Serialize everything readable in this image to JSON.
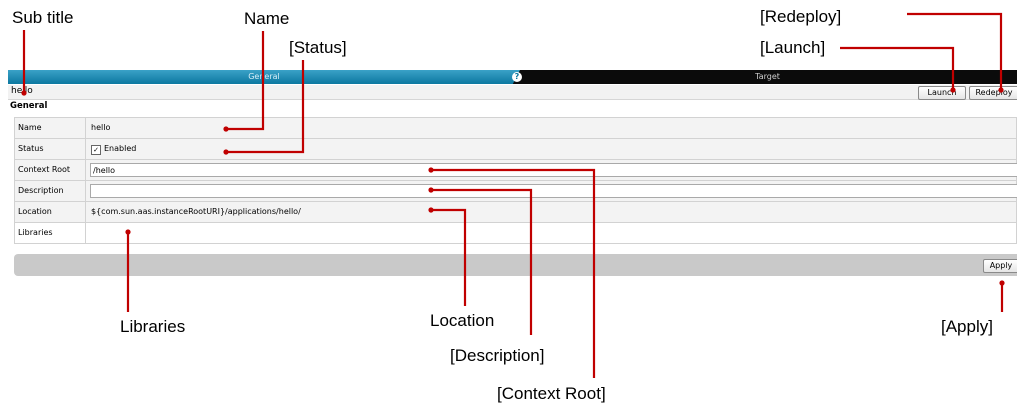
{
  "tabs": [
    {
      "label": "General",
      "active": true
    },
    {
      "label": "Target",
      "active": false
    }
  ],
  "help_icon_glyph": "?",
  "subtitle": "hello",
  "buttons": {
    "launch": "Launch",
    "redeploy": "Redeploy",
    "apply": "Apply"
  },
  "section_title": "General",
  "form": {
    "name_label": "Name",
    "name_value": "hello",
    "status_label": "Status",
    "status_value": "Enabled",
    "status_checked": true,
    "context_root_label": "Context Root",
    "context_root_value": "/hello",
    "description_label": "Description",
    "description_value": "",
    "location_label": "Location",
    "location_value": "${com.sun.aas.instanceRootURI}/applications/hello/",
    "libraries_label": "Libraries"
  },
  "annotations": {
    "sub_title": "Sub title",
    "name": "Name",
    "status": "[Status]",
    "redeploy": "[Redeploy]",
    "launch": "[Launch]",
    "libraries": "Libraries",
    "location": "Location",
    "description": "[Description]",
    "context_root": "[Context Root]",
    "apply": "[Apply]"
  },
  "colors": {
    "callout_line": "#c00000",
    "tab_active": "#0c78a0",
    "tab_bar": "#0b0b0b"
  }
}
